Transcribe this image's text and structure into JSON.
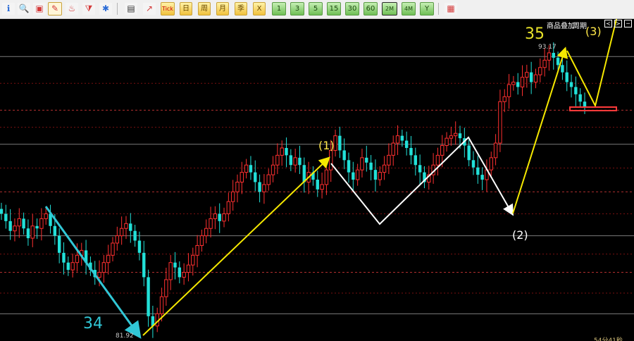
{
  "toolbar": {
    "icons": [
      {
        "name": "info-icon",
        "glyph": "ℹ",
        "color": "#2a6bd6"
      },
      {
        "name": "search-icon",
        "glyph": "🔍",
        "color": "#3a3a3a"
      },
      {
        "name": "window-icon",
        "glyph": "▣",
        "color": "#d43a3a"
      },
      {
        "name": "pencil-icon",
        "glyph": "✎",
        "color": "#d43a3a"
      },
      {
        "name": "paint-icon",
        "glyph": "♨",
        "color": "#d43a3a"
      },
      {
        "name": "filter-icon",
        "glyph": "⧩",
        "color": "#d43a3a"
      },
      {
        "name": "new-icon",
        "glyph": "✱",
        "color": "#2a6bd6"
      },
      {
        "name": "table-icon",
        "glyph": "▤",
        "color": "#333333"
      },
      {
        "name": "line-chart-icon",
        "glyph": "↗",
        "color": "#d43a3a"
      }
    ],
    "tick_label": "Tick",
    "period_labels": [
      "日",
      "周",
      "月",
      "季",
      "X"
    ],
    "minute_labels": [
      "1",
      "3",
      "5",
      "15",
      "30",
      "60"
    ],
    "extra_labels": [
      "2M",
      "4M",
      "Y"
    ],
    "tail_icon": "calendar-icon"
  },
  "controls": {
    "overlay_label": "商品叠加",
    "period_label": "周期",
    "nav_buttons": [
      "≺",
      "≻",
      "─"
    ]
  },
  "annotations": {
    "wave_34": "34",
    "wave_35": "35",
    "wave_1": "(1)",
    "wave_2": "(2)",
    "wave_3": "(3)"
  },
  "price_labels": {
    "high": "93.17",
    "low": "81.92"
  },
  "status": {
    "timer": "54分41秒"
  },
  "colors": {
    "up_candle": "#ff3030",
    "down_candle": "#22e0d8",
    "yellow_arrow": "#f5e800",
    "white_arrow": "#ffffff",
    "cyan_arrow": "#31c7d6",
    "target_box": "#ff3a3a"
  },
  "chart_data": {
    "type": "candlestick",
    "ylim": [
      81.5,
      94.5
    ],
    "high": 93.17,
    "low": 81.92,
    "closes": [
      86.6,
      86.3,
      85.9,
      86.1,
      86.4,
      86.0,
      85.6,
      86.1,
      86.0,
      86.4,
      86.6,
      86.1,
      85.7,
      85.0,
      84.6,
      84.3,
      84.6,
      84.9,
      85.1,
      84.6,
      84.3,
      84.0,
      84.2,
      84.6,
      84.9,
      85.4,
      85.7,
      86.0,
      86.2,
      85.9,
      85.5,
      85.0,
      84.0,
      82.4,
      82.0,
      82.5,
      83.2,
      83.9,
      84.6,
      84.4,
      84.0,
      84.2,
      84.5,
      84.9,
      85.3,
      85.7,
      86.0,
      86.4,
      86.6,
      86.3,
      86.6,
      87.1,
      87.5,
      87.9,
      88.3,
      88.6,
      88.3,
      87.9,
      87.5,
      87.8,
      88.2,
      88.6,
      89.0,
      89.3,
      89.0,
      88.6,
      88.9,
      88.6,
      87.9,
      88.3,
      88.0,
      87.6,
      87.8,
      88.4,
      89.2,
      89.8,
      89.2,
      88.8,
      88.3,
      88.0,
      88.4,
      88.9,
      88.7,
      88.4,
      88.0,
      88.3,
      88.6,
      89.0,
      89.5,
      89.8,
      89.6,
      89.3,
      89.0,
      88.6,
      88.3,
      87.9,
      88.2,
      88.6,
      89.0,
      89.4,
      89.7,
      89.8,
      89.9,
      89.7,
      89.4,
      88.8,
      88.5,
      88.2,
      88.0,
      88.4,
      88.9,
      89.5,
      91.2,
      91.4,
      91.9,
      92.0,
      91.8,
      92.2,
      92.4,
      92.0,
      92.3,
      92.6,
      92.9,
      93.2,
      93.0,
      92.7,
      92.4,
      92.0,
      91.8,
      91.5,
      91.2,
      91.0
    ],
    "horizontal_levels": [
      93.05,
      90.85,
      89.45,
      87.5,
      85.7,
      84.2,
      82.5
    ],
    "markers": [
      {
        "label": "34",
        "price": 81.92
      },
      {
        "label": "(1)",
        "price": 89.9
      },
      {
        "label": "(2)",
        "price": 87.6
      },
      {
        "label": "35",
        "price": 93.17
      },
      {
        "label": "(3)",
        "price": 94.5
      }
    ]
  }
}
